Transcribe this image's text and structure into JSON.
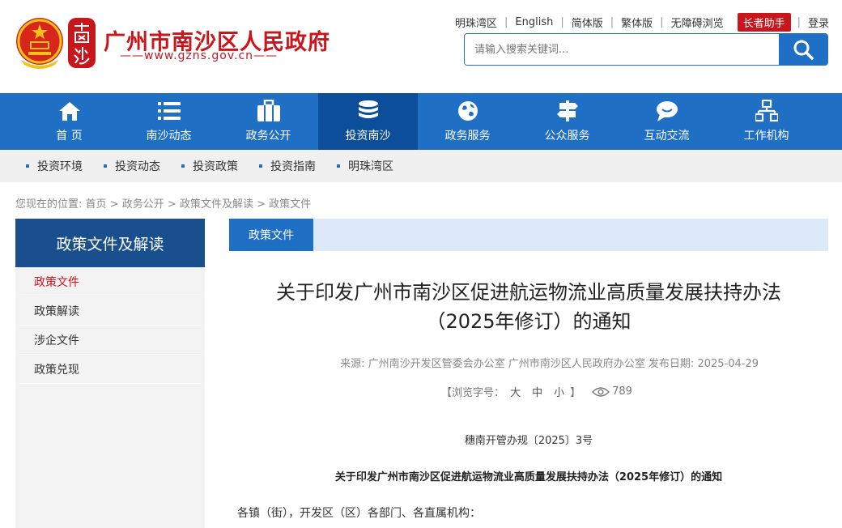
{
  "header": {
    "title": "广州市南沙区人民政府",
    "url": "——www.gzns.gov.cn——",
    "seal_text": "南沙",
    "brand_color": "#c8161d"
  },
  "toplinks": [
    "明珠湾区",
    "English",
    "简体版",
    "繁体版",
    "无障碍浏览"
  ],
  "elder_label": "长者助手",
  "login_label": "登录",
  "search": {
    "placeholder": "请输入搜索关键词...",
    "icon": "search-icon"
  },
  "nav": [
    {
      "label": "首 页",
      "icon": "home-icon"
    },
    {
      "label": "南沙动态",
      "icon": "list-icon"
    },
    {
      "label": "政务公开",
      "icon": "briefcase-icon"
    },
    {
      "label": "投资南沙",
      "icon": "coins-icon",
      "active": true
    },
    {
      "label": "政务服务",
      "icon": "globe-icon"
    },
    {
      "label": "公众服务",
      "icon": "signpost-icon"
    },
    {
      "label": "互动交流",
      "icon": "chat-icon"
    },
    {
      "label": "工作机构",
      "icon": "org-chart-icon"
    }
  ],
  "subnav": [
    "投资环境",
    "投资动态",
    "投资政策",
    "投资指南",
    "明珠湾区"
  ],
  "breadcrumb": {
    "prefix": "您现在的位置:",
    "items": [
      "首页",
      "政务公开",
      "政策文件及解读",
      "政策文件"
    ],
    "separator": ">"
  },
  "sidebar": {
    "title": "政策文件及解读",
    "items": [
      "政策文件",
      "政策解读",
      "涉企文件",
      "政策兑现"
    ]
  },
  "tab": {
    "label": "政策文件"
  },
  "doc": {
    "title_line1": "关于印发广州市南沙区促进航运物流业高质量发展扶持办法",
    "title_line2": "（2025年修订）的通知",
    "meta": "来源:  广州南沙开发区管委会办公室 广州市南沙区人民政府办公室   发布日期:  2025-04-29",
    "fontsize_label": "【浏览字号：",
    "size_large": "大",
    "size_medium": "中",
    "size_small": "小",
    "fontsize_end": "】",
    "views": "789",
    "doc_no": "穗南开管办规〔2025〕3号",
    "subtitle": "关于印发广州市南沙区促进航运物流业高质量发展扶持办法（2025年修订）的通知",
    "salutation": "各镇（街），开发区（区）各部门、各直属机构："
  },
  "colors": {
    "nav_blue": "#1f6fc5",
    "nav_active": "#0d4e9a",
    "sidebar_head": "#1a4f8d",
    "accent_red": "#c8161d"
  }
}
